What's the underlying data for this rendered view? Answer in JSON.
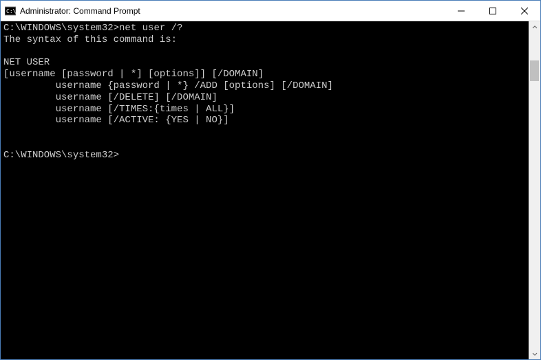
{
  "window": {
    "title": "Administrator: Command Prompt"
  },
  "terminal": {
    "prompt1": "C:\\WINDOWS\\system32>",
    "command1": "net user /?",
    "output": [
      "The syntax of this command is:",
      "",
      "NET USER",
      "[username [password | *] [options]] [/DOMAIN]",
      "         username {password | *} /ADD [options] [/DOMAIN]",
      "         username [/DELETE] [/DOMAIN]",
      "         username [/TIMES:{times | ALL}]",
      "         username [/ACTIVE: {YES | NO}]",
      "",
      ""
    ],
    "prompt2": "C:\\WINDOWS\\system32>"
  }
}
